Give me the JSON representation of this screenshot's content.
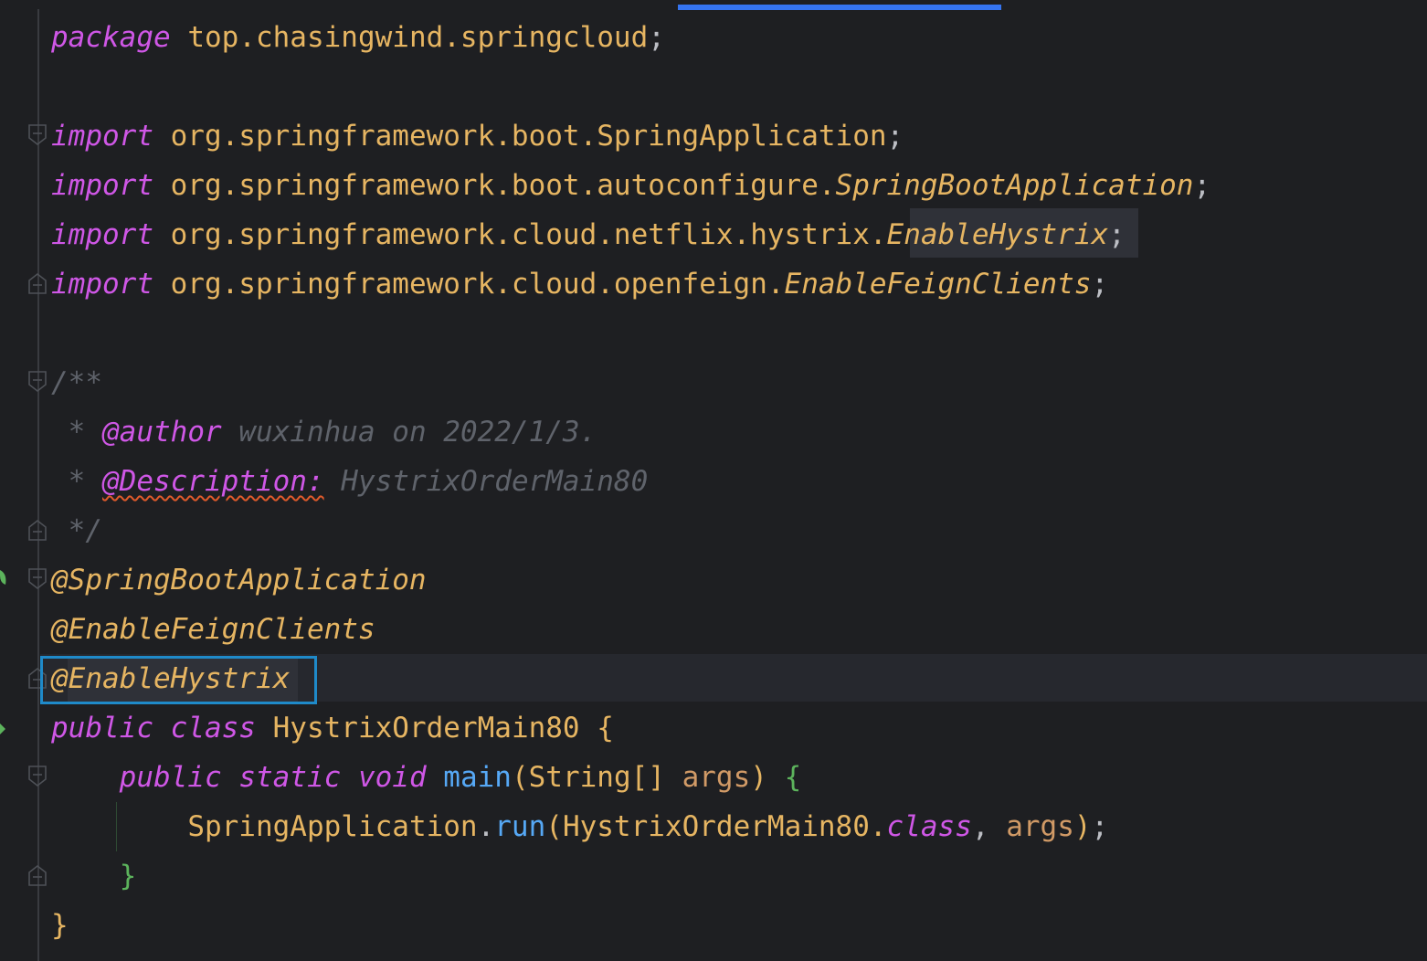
{
  "editor": {
    "lines": {
      "l1": {
        "kw": "package",
        "text": " top.chasingwind.springcloud",
        "end": ";"
      },
      "l3": {
        "kw": "import",
        "text": " org.springframework.boot.SpringApplication",
        "end": ";"
      },
      "l4": {
        "kw": "import",
        "text": " org.springframework.boot.autoconfigure.",
        "cls": "SpringBootApplication",
        "end": ";"
      },
      "l5": {
        "kw": "import",
        "text": " org.springframework.cloud.netflix.hystrix.",
        "cls": "EnableHystrix",
        "end": ";"
      },
      "l6": {
        "kw": "import",
        "text": " org.springframework.cloud.openfeign.",
        "cls": "EnableFeignClients",
        "end": ";"
      },
      "l8": {
        "text": "/**"
      },
      "l9": {
        "star": " * ",
        "tag": "@author",
        "text": " wuxinhua on 2022/1/3."
      },
      "l10": {
        "star": " * ",
        "tag": "@Description:",
        "text": " HystrixOrderMain80"
      },
      "l11": {
        "text": " */"
      },
      "l12": {
        "ann": "@SpringBootApplication"
      },
      "l13": {
        "ann": "@EnableFeignClients"
      },
      "l14": {
        "ann": "@EnableHystrix"
      },
      "l15": {
        "kw1": "public",
        "kw2": "class",
        "name": " HystrixOrderMain80 ",
        "brace": "{"
      },
      "l16": {
        "kw1": "public",
        "kw2": "static",
        "kw3": "void",
        "fn": "main",
        "open": "(",
        "type": "String[] ",
        "param": "args",
        "close": ")",
        "brace": "{"
      },
      "l17": {
        "cls": "SpringApplication",
        "dot": ".",
        "fn": "run",
        "open": "(",
        "arg": "HystrixOrderMain80.",
        "kw": "class",
        "comma": ", ",
        "param": "args",
        "close": ")",
        "end": ";"
      },
      "l18": {
        "brace": "}"
      },
      "l19": {
        "brace": "}"
      }
    },
    "colors": {
      "background": "#1e1f22",
      "keyword": "#cf57e6",
      "class": "#e6b562",
      "comment": "#5f636b",
      "function": "#56a8f5",
      "param": "#d19a66",
      "selection_box": "#1f8ac9",
      "tab_indicator": "#3574f0"
    }
  }
}
